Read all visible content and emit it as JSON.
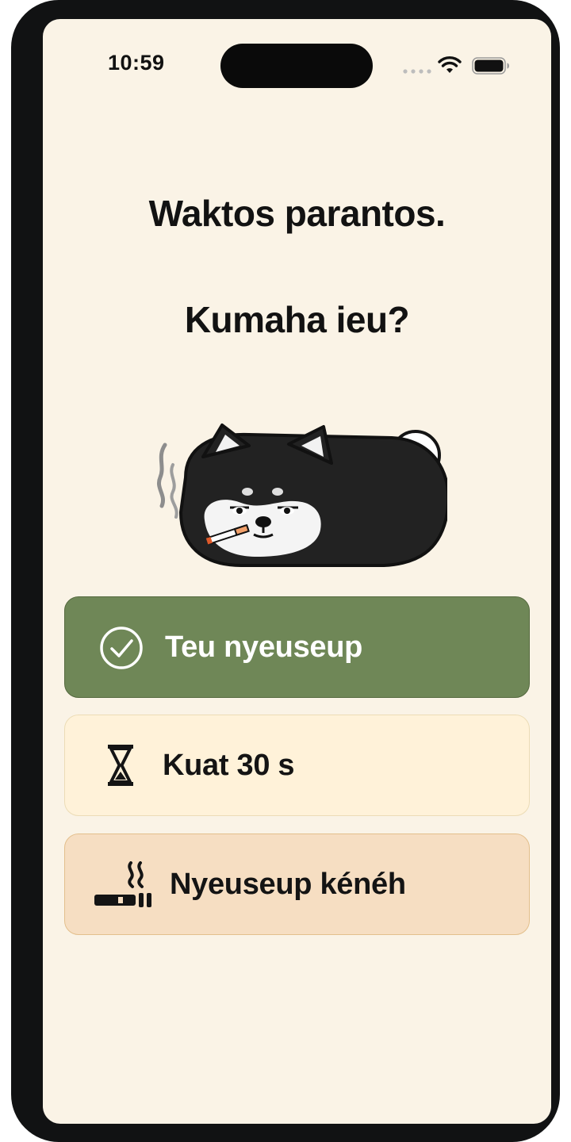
{
  "status_bar": {
    "time": "10:59"
  },
  "prompt": {
    "line1": "Waktos parantos.",
    "line2": "Kumaha ieu?"
  },
  "options": [
    {
      "label": "Teu nyeuseup",
      "icon": "check-circle-icon",
      "color": "#6f8757"
    },
    {
      "label": "Kuat 30 s",
      "icon": "hourglass-icon",
      "color": "#fff2d9"
    },
    {
      "label": "Nyeuseup kénéh",
      "icon": "smoking-cigarette-icon",
      "color": "#f6dec2"
    }
  ],
  "mascot": {
    "icon": "smoking-dog-mascot"
  }
}
